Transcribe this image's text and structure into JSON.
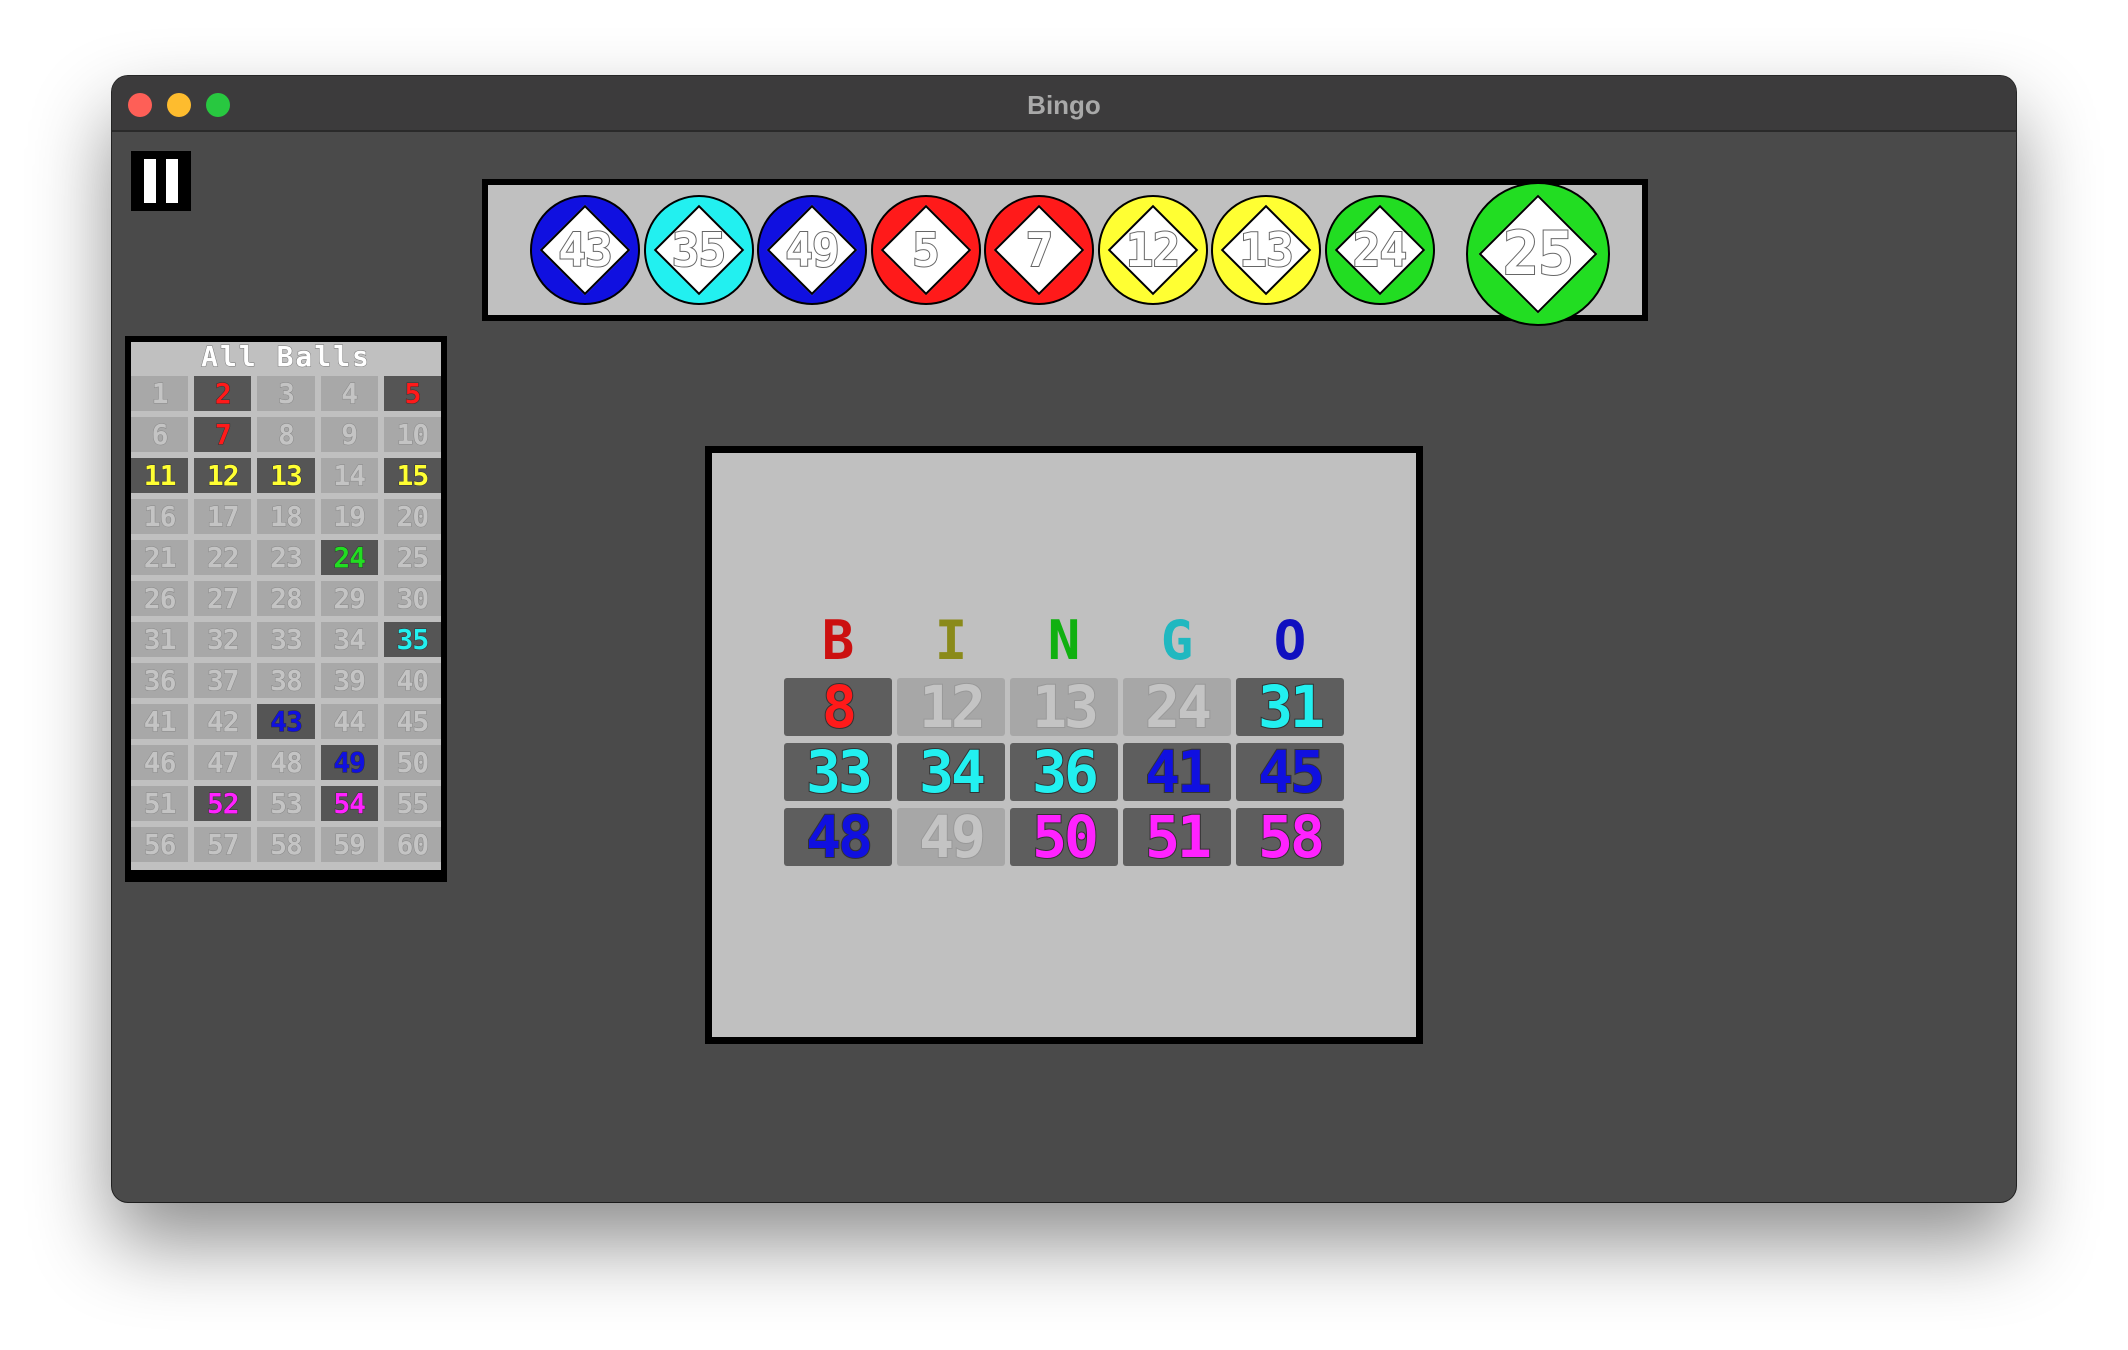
{
  "window": {
    "title": "Bingo"
  },
  "pause_button": {
    "icon": "pause-icon"
  },
  "colors": {
    "red": "#ff1a1a",
    "yellow": "#ffff33",
    "green": "#22dd22",
    "cyan": "#22f0f0",
    "blue": "#1010e0",
    "magenta": "#ff22ff",
    "letter_b": "#cc1010",
    "letter_i": "#8a8a1a",
    "letter_n": "#10b010",
    "letter_g": "#20b8c0",
    "letter_o": "#1010c0"
  },
  "recent_balls": [
    {
      "number": "43",
      "color": "blue"
    },
    {
      "number": "35",
      "color": "cyan"
    },
    {
      "number": "49",
      "color": "blue"
    },
    {
      "number": "5",
      "color": "red"
    },
    {
      "number": "7",
      "color": "red"
    },
    {
      "number": "12",
      "color": "yellow"
    },
    {
      "number": "13",
      "color": "yellow"
    },
    {
      "number": "24",
      "color": "green"
    }
  ],
  "current_ball": {
    "number": "25",
    "color": "green"
  },
  "all_balls": {
    "title": "All Balls",
    "numbers": [
      "1",
      "2",
      "3",
      "4",
      "5",
      "6",
      "7",
      "8",
      "9",
      "10",
      "11",
      "12",
      "13",
      "14",
      "15",
      "16",
      "17",
      "18",
      "19",
      "20",
      "21",
      "22",
      "23",
      "24",
      "25",
      "26",
      "27",
      "28",
      "29",
      "30",
      "31",
      "32",
      "33",
      "34",
      "35",
      "36",
      "37",
      "38",
      "39",
      "40",
      "41",
      "42",
      "43",
      "44",
      "45",
      "46",
      "47",
      "48",
      "49",
      "50",
      "51",
      "52",
      "53",
      "54",
      "55",
      "56",
      "57",
      "58",
      "59",
      "60"
    ],
    "called": {
      "2": "red",
      "5": "red",
      "7": "red",
      "11": "yellow",
      "12": "yellow",
      "13": "yellow",
      "15": "yellow",
      "24": "green",
      "35": "cyan",
      "43": "blue",
      "49": "blue",
      "52": "magenta",
      "54": "magenta"
    }
  },
  "card": {
    "header": [
      "B",
      "I",
      "N",
      "G",
      "O"
    ],
    "rows": [
      [
        {
          "n": "8",
          "color": "red",
          "marked": true
        },
        {
          "n": "12",
          "color": "yellow",
          "marked": false
        },
        {
          "n": "13",
          "color": "yellow",
          "marked": false
        },
        {
          "n": "24",
          "color": "green",
          "marked": false
        },
        {
          "n": "31",
          "color": "cyan",
          "marked": true
        }
      ],
      [
        {
          "n": "33",
          "color": "cyan",
          "marked": true
        },
        {
          "n": "34",
          "color": "cyan",
          "marked": true
        },
        {
          "n": "36",
          "color": "cyan",
          "marked": true
        },
        {
          "n": "41",
          "color": "blue",
          "marked": true
        },
        {
          "n": "45",
          "color": "blue",
          "marked": true
        }
      ],
      [
        {
          "n": "48",
          "color": "blue",
          "marked": true
        },
        {
          "n": "49",
          "color": "blue",
          "marked": false
        },
        {
          "n": "50",
          "color": "magenta",
          "marked": true
        },
        {
          "n": "51",
          "color": "magenta",
          "marked": true
        },
        {
          "n": "58",
          "color": "magenta",
          "marked": true
        }
      ]
    ]
  }
}
